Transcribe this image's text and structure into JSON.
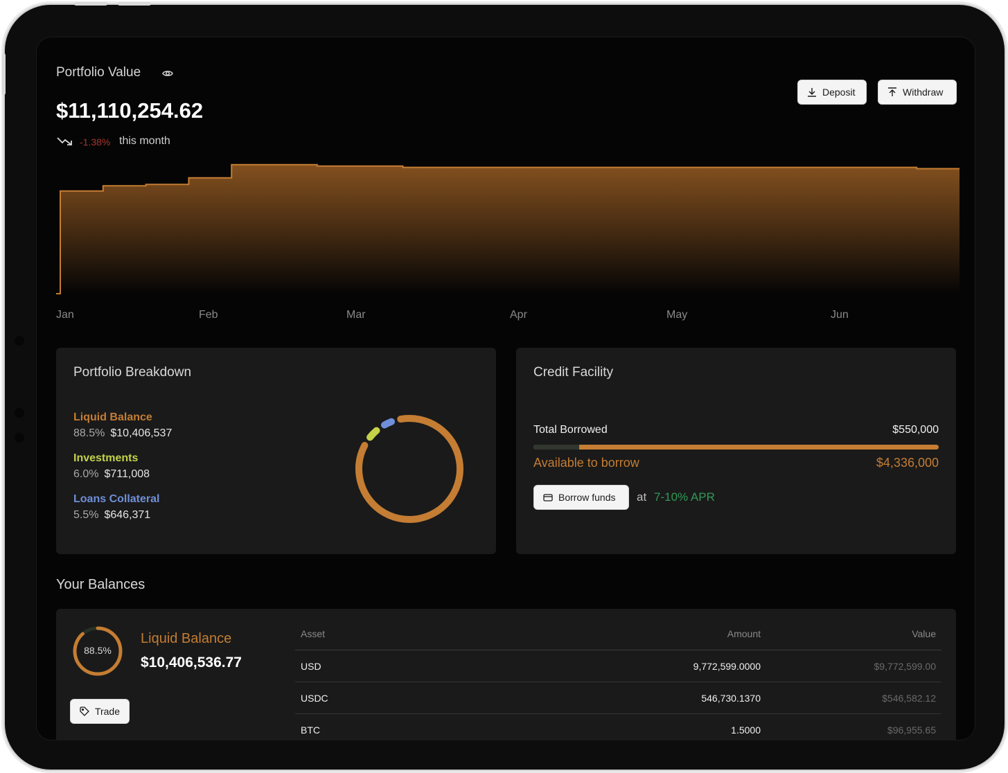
{
  "header": {
    "title": "Portfolio Value",
    "value": "$11,110,254.62",
    "change_pct": "-1.38%",
    "change_suffix": "this month",
    "deposit_label": "Deposit",
    "withdraw_label": "Withdraw"
  },
  "chart_data": {
    "type": "area",
    "x_ticks": [
      "Jan",
      "Feb",
      "Mar",
      "Apr",
      "May",
      "Jun"
    ],
    "series": [
      {
        "values": [
          0,
          0.78,
          0.82,
          0.83,
          0.88,
          0.98,
          0.98,
          0.97,
          0.97,
          0.96,
          0.96,
          0.96,
          0.96,
          0.96,
          0.96,
          0.96,
          0.96,
          0.96,
          0.96,
          0.96,
          0.96,
          0.95,
          0.95
        ]
      }
    ],
    "colors": {
      "line": "#c47d33",
      "fill_top": "#8a5420",
      "fill_bottom": "#050505"
    }
  },
  "breakdown": {
    "title": "Portfolio Breakdown",
    "items": [
      {
        "label": "Liquid Balance",
        "pct": "88.5%",
        "amount": "$10,406,537",
        "color": "#c47d33",
        "fraction": 0.885
      },
      {
        "label": "Investments",
        "pct": "6.0%",
        "amount": "$711,008",
        "color": "#c4d24a",
        "fraction": 0.06
      },
      {
        "label": "Loans Collateral",
        "pct": "5.5%",
        "amount": "$646,371",
        "color": "#6f8fd8",
        "fraction": 0.055
      }
    ]
  },
  "credit": {
    "title": "Credit Facility",
    "borrowed_label": "Total Borrowed",
    "borrowed_amount": "$550,000",
    "borrowed_fraction": 0.112,
    "available_label": "Available to borrow",
    "available_amount": "$4,336,000",
    "borrow_label": "Borrow funds",
    "at": "at",
    "apr": "7-10% APR"
  },
  "balances": {
    "title": "Your Balances",
    "ring_pct": "88.5%",
    "ring_fraction": 0.885,
    "label": "Liquid Balance",
    "value": "$10,406,536.77",
    "trade_label": "Trade",
    "columns": [
      "Asset",
      "Amount",
      "Value"
    ],
    "rows": [
      {
        "asset": "USD",
        "amount": "9,772,599.0000",
        "value": "$9,772,599.00"
      },
      {
        "asset": "USDC",
        "amount": "546,730.1370",
        "value": "$546,582.12"
      },
      {
        "asset": "BTC",
        "amount": "1.5000",
        "value": "$96,955.65"
      }
    ]
  },
  "icons": [
    "eye-icon",
    "trend-down-icon",
    "download-icon",
    "upload-icon",
    "card-icon",
    "tag-icon"
  ]
}
